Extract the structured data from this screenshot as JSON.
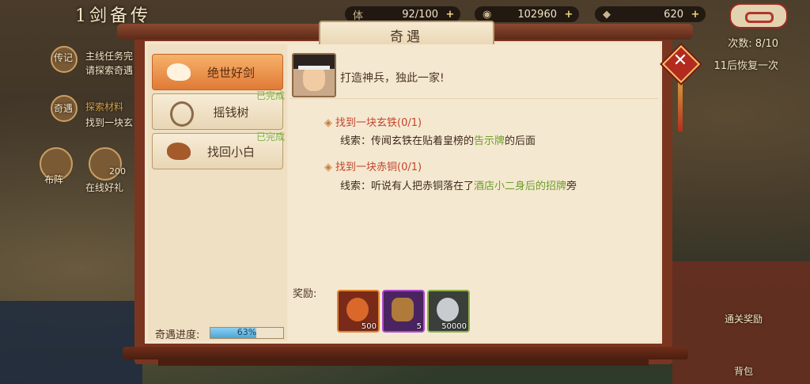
{
  "top": {
    "title": "1剑备传",
    "stamina": {
      "label": "体",
      "value": "92/100"
    },
    "silver": {
      "value": "102960"
    },
    "gold": {
      "value": "620"
    }
  },
  "hud_left": {
    "line1": "主线任务完",
    "line2": "请探索奇遇",
    "line3": "探索材料",
    "line4": "找到一块玄",
    "tag1": "传记",
    "tag2": "奇遇",
    "label_a": "布阵",
    "label_b": "在线好礼",
    "count_b": "200"
  },
  "hud_right": {
    "chance": "次数: 8/10",
    "recover": "11后恢复一次",
    "reward": "通关奖励",
    "bag": "背包"
  },
  "dialog": {
    "title": "奇遇",
    "tabs": [
      {
        "label": "绝世好剑",
        "active": true,
        "done": ""
      },
      {
        "label": "摇钱树",
        "active": false,
        "done": "已完成"
      },
      {
        "label": "找回小白",
        "active": false,
        "done": "已完成"
      }
    ],
    "progress_label": "奇遇进度:",
    "progress_value": 0.63,
    "progress_text": "63%",
    "intro": "打造神兵，独此一家!",
    "tasks": [
      {
        "title": "找到一块玄铁(0/1)",
        "clue_pre": "线索：传闻玄铁在贴着皇榜的",
        "clue_hl": "告示牌",
        "clue_post": "的后面"
      },
      {
        "title": "找到一块赤铜(0/1)",
        "clue_pre": "线索：听说有人把赤铜落在了",
        "clue_hl": "酒店小二身后的招牌",
        "clue_post": "旁"
      }
    ],
    "reward_label": "奖励:",
    "rewards": [
      {
        "count": "500",
        "color": "#d9682a"
      },
      {
        "count": "5",
        "color": "#8a3aa8"
      },
      {
        "count": "50000",
        "color": "#6a7f4a"
      }
    ]
  }
}
